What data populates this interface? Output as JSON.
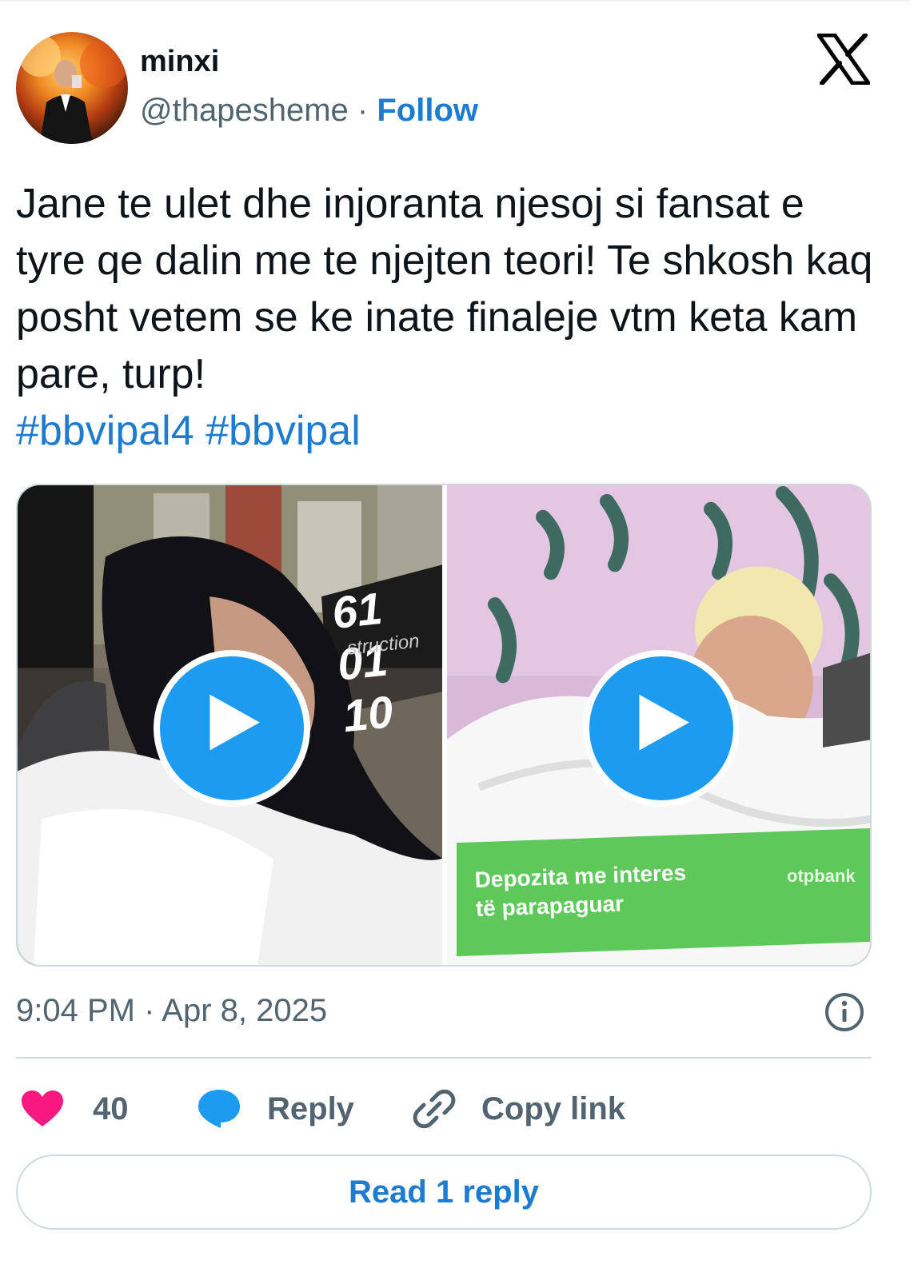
{
  "author": {
    "display_name": "minxi",
    "handle": "@thapesheme",
    "separator": "·",
    "follow_label": "Follow"
  },
  "platform_icon": "x-logo-icon",
  "tweet": {
    "text": "Jane te ulet dhe injoranta njesoj si fansat e tyre qe dalin me te njejten teori! Te shkosh kaq posht vetem se ke inate finaleje vtm keta kam pare, turp!",
    "hashtags": [
      "#bbvipal4",
      "#bbvipal"
    ]
  },
  "media": {
    "left_video": {
      "overlay_number": "61 01 10",
      "overlay_sub": "struction"
    },
    "right_video": {
      "banner_line1": "Depozita me interes",
      "banner_line2": "të parapaguar",
      "banner_brand": "otpbank"
    }
  },
  "timestamp": "9:04 PM · Apr 8, 2025",
  "actions": {
    "like_count": "40",
    "reply_label": "Reply",
    "copy_label": "Copy link"
  },
  "read_replies_label": "Read 1 reply",
  "colors": {
    "link": "#1d7bd0",
    "like": "#f91880",
    "reply_icon": "#1d9bf0",
    "play": "#1d9bf0",
    "muted": "#536471"
  }
}
